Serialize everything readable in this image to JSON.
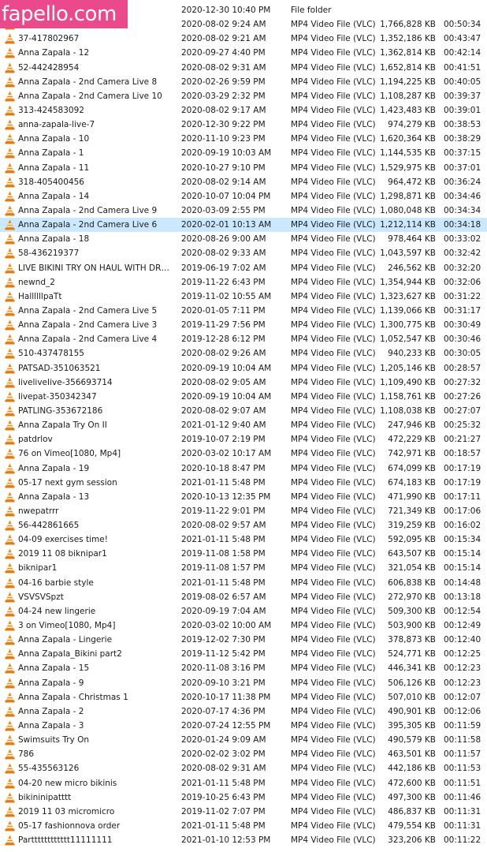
{
  "watermark": "fapello.com",
  "icon": "vlc-cone-icon",
  "colors": {
    "cone_orange": "#f08a16",
    "cone_stripe": "#ffffff",
    "selected_row": "#cce8ff",
    "watermark_bg": "#ea4a8c"
  },
  "rows": [
    {
      "name": "",
      "date": "2020-12-30 10:40 PM",
      "type": "File folder",
      "size": "",
      "duration": ""
    },
    {
      "name": "",
      "date": "2020-08-02 9:24 AM",
      "type": "MP4 Video File (VLC)",
      "size": "1,766,828 KB",
      "duration": "00:50:34"
    },
    {
      "name": "37-417802967",
      "date": "2020-08-02 9:21 AM",
      "type": "MP4 Video File (VLC)",
      "size": "1,352,186 KB",
      "duration": "00:43:47"
    },
    {
      "name": "Anna Zapala - 12",
      "date": "2020-09-27 4:40 PM",
      "type": "MP4 Video File (VLC)",
      "size": "1,362,814 KB",
      "duration": "00:42:14"
    },
    {
      "name": "52-442428954",
      "date": "2020-08-02 9:31 AM",
      "type": "MP4 Video File (VLC)",
      "size": "1,652,814 KB",
      "duration": "00:41:51"
    },
    {
      "name": "Anna Zapala - 2nd Camera Live 8",
      "date": "2020-02-26 9:59 PM",
      "type": "MP4 Video File (VLC)",
      "size": "1,194,225 KB",
      "duration": "00:40:05"
    },
    {
      "name": "Anna Zapala - 2nd Camera Live 10",
      "date": "2020-03-29 2:32 PM",
      "type": "MP4 Video File (VLC)",
      "size": "1,108,287 KB",
      "duration": "00:39:37"
    },
    {
      "name": "313-424583092",
      "date": "2020-08-02 9:17 AM",
      "type": "MP4 Video File (VLC)",
      "size": "1,423,483 KB",
      "duration": "00:39:01"
    },
    {
      "name": "anna-zapala-live-7",
      "date": "2020-12-30 9:22 PM",
      "type": "MP4 Video File (VLC)",
      "size": "974,279 KB",
      "duration": "00:38:53"
    },
    {
      "name": "Anna Zapala - 10",
      "date": "2020-11-10 9:23 PM",
      "type": "MP4 Video File (VLC)",
      "size": "1,620,364 KB",
      "duration": "00:38:29"
    },
    {
      "name": "Anna Zapala - 1",
      "date": "2020-09-19 10:03 AM",
      "type": "MP4 Video File (VLC)",
      "size": "1,144,535 KB",
      "duration": "00:37:15"
    },
    {
      "name": "Anna Zapala - 11",
      "date": "2020-10-27 9:10 PM",
      "type": "MP4 Video File (VLC)",
      "size": "1,529,975 KB",
      "duration": "00:37:01"
    },
    {
      "name": "318-405400456",
      "date": "2020-08-02 9:14 AM",
      "type": "MP4 Video File (VLC)",
      "size": "964,472 KB",
      "duration": "00:36:24"
    },
    {
      "name": "Anna Zapala - 14",
      "date": "2020-10-07 10:04 PM",
      "type": "MP4 Video File (VLC)",
      "size": "1,298,871 KB",
      "duration": "00:34:46"
    },
    {
      "name": "Anna Zapala - 2nd Camera Live 9",
      "date": "2020-03-09 2:55 PM",
      "type": "MP4 Video File (VLC)",
      "size": "1,080,048 KB",
      "duration": "00:34:34"
    },
    {
      "name": "Anna Zapala - 2nd Camera Live 6",
      "date": "2020-02-01 10:13 AM",
      "type": "MP4 Video File (VLC)",
      "size": "1,212,114 KB",
      "duration": "00:34:18",
      "selected": true
    },
    {
      "name": "Anna Zapala - 18",
      "date": "2020-08-26 9:00 AM",
      "type": "MP4 Video File (VLC)",
      "size": "978,464 KB",
      "duration": "00:33:02"
    },
    {
      "name": "58-436219377",
      "date": "2020-08-02 9:33 AM",
      "type": "MP4 Video File (VLC)",
      "size": "1,043,597 KB",
      "duration": "00:32:42"
    },
    {
      "name": "LIVE  BIKINI TRY ON HAUL WITH DRESSLI...",
      "date": "2019-06-19 7:02 AM",
      "type": "MP4 Video File (VLC)",
      "size": "246,562 KB",
      "duration": "00:32:20"
    },
    {
      "name": "newnd_2",
      "date": "2019-11-22 6:43 PM",
      "type": "MP4 Video File (VLC)",
      "size": "1,354,944 KB",
      "duration": "00:32:06"
    },
    {
      "name": "HallllllpaTt",
      "date": "2019-11-02 10:55 AM",
      "type": "MP4 Video File (VLC)",
      "size": "1,323,627 KB",
      "duration": "00:31:22"
    },
    {
      "name": "Anna Zapala - 2nd Camera Live 5",
      "date": "2020-01-05 7:11 PM",
      "type": "MP4 Video File (VLC)",
      "size": "1,139,066 KB",
      "duration": "00:31:17"
    },
    {
      "name": "Anna Zapala - 2nd Camera Live 3",
      "date": "2019-11-29 7:56 PM",
      "type": "MP4 Video File (VLC)",
      "size": "1,300,775 KB",
      "duration": "00:30:49"
    },
    {
      "name": "Anna Zapala - 2nd Camera Live 4",
      "date": "2019-12-28 6:12 PM",
      "type": "MP4 Video File (VLC)",
      "size": "1,052,547 KB",
      "duration": "00:30:46"
    },
    {
      "name": "510-437478155",
      "date": "2020-08-02 9:26 AM",
      "type": "MP4 Video File (VLC)",
      "size": "940,233 KB",
      "duration": "00:30:05"
    },
    {
      "name": "PATSAD-351063521",
      "date": "2020-09-19 10:04 AM",
      "type": "MP4 Video File (VLC)",
      "size": "1,205,146 KB",
      "duration": "00:28:57"
    },
    {
      "name": "liveliveIive-356693714",
      "date": "2020-08-02 9:05 AM",
      "type": "MP4 Video File (VLC)",
      "size": "1,109,490 KB",
      "duration": "00:27:32"
    },
    {
      "name": "livepat-350342347",
      "date": "2020-09-19 10:04 AM",
      "type": "MP4 Video File (VLC)",
      "size": "1,158,761 KB",
      "duration": "00:27:26"
    },
    {
      "name": "PATLING-353672186",
      "date": "2020-08-02 9:07 AM",
      "type": "MP4 Video File (VLC)",
      "size": "1,108,038 KB",
      "duration": "00:27:07"
    },
    {
      "name": "Anna Zapala Try On II",
      "date": "2021-01-12 9:40 AM",
      "type": "MP4 Video File (VLC)",
      "size": "247,946 KB",
      "duration": "00:25:32"
    },
    {
      "name": "patdrlov",
      "date": "2019-10-07 2:19 PM",
      "type": "MP4 Video File (VLC)",
      "size": "472,229 KB",
      "duration": "00:21:27"
    },
    {
      "name": "76 on Vimeo[1080, Mp4]",
      "date": "2020-03-02 10:17 AM",
      "type": "MP4 Video File (VLC)",
      "size": "742,971 KB",
      "duration": "00:18:57"
    },
    {
      "name": "Anna Zapala - 19",
      "date": "2020-10-18 8:47 PM",
      "type": "MP4 Video File (VLC)",
      "size": "674,099 KB",
      "duration": "00:17:19"
    },
    {
      "name": "05-17 next gym session",
      "date": "2021-01-11 5:48 PM",
      "type": "MP4 Video File (VLC)",
      "size": "674,183 KB",
      "duration": "00:17:19"
    },
    {
      "name": "Anna Zapala - 13",
      "date": "2020-10-13 12:35 PM",
      "type": "MP4 Video File (VLC)",
      "size": "471,990 KB",
      "duration": "00:17:11"
    },
    {
      "name": "nwepatrrr",
      "date": "2019-11-22 9:01 PM",
      "type": "MP4 Video File (VLC)",
      "size": "721,349 KB",
      "duration": "00:17:06"
    },
    {
      "name": "56-442861665",
      "date": "2020-08-02 9:57 AM",
      "type": "MP4 Video File (VLC)",
      "size": "319,259 KB",
      "duration": "00:16:02"
    },
    {
      "name": "04-09 exercises time!",
      "date": "2021-01-11 5:48 PM",
      "type": "MP4 Video File (VLC)",
      "size": "592,095 KB",
      "duration": "00:15:34"
    },
    {
      "name": "2019 11 08 biknipar1",
      "date": "2019-11-08 1:58 PM",
      "type": "MP4 Video File (VLC)",
      "size": "643,507 KB",
      "duration": "00:15:14"
    },
    {
      "name": "biknipar1",
      "date": "2019-11-08 1:57 PM",
      "type": "MP4 Video File (VLC)",
      "size": "321,054 KB",
      "duration": "00:15:14"
    },
    {
      "name": "04-16 barbie style",
      "date": "2021-01-11 5:48 PM",
      "type": "MP4 Video File (VLC)",
      "size": "606,838 KB",
      "duration": "00:14:48"
    },
    {
      "name": "VSVSVSpzt",
      "date": "2019-08-02 6:57 AM",
      "type": "MP4 Video File (VLC)",
      "size": "272,970 KB",
      "duration": "00:13:18"
    },
    {
      "name": "04-24 new lingerie",
      "date": "2020-09-19 7:04 AM",
      "type": "MP4 Video File (VLC)",
      "size": "509,300 KB",
      "duration": "00:12:54"
    },
    {
      "name": "3 on Vimeo[1080, Mp4]",
      "date": "2020-03-02 10:00 AM",
      "type": "MP4 Video File (VLC)",
      "size": "503,900 KB",
      "duration": "00:12:49"
    },
    {
      "name": "Anna Zapala - Lingerie",
      "date": "2019-12-02 7:30 PM",
      "type": "MP4 Video File (VLC)",
      "size": "378,873 KB",
      "duration": "00:12:40"
    },
    {
      "name": "Anna Zapala_Bikini part2",
      "date": "2019-11-12 5:42 PM",
      "type": "MP4 Video File (VLC)",
      "size": "524,771 KB",
      "duration": "00:12:25"
    },
    {
      "name": "Anna Zapala - 15",
      "date": "2020-11-08 3:16 PM",
      "type": "MP4 Video File (VLC)",
      "size": "446,341 KB",
      "duration": "00:12:23"
    },
    {
      "name": "Anna Zapala - 9",
      "date": "2020-09-10 3:21 PM",
      "type": "MP4 Video File (VLC)",
      "size": "506,126 KB",
      "duration": "00:12:23"
    },
    {
      "name": "Anna Zapala - Christmas 1",
      "date": "2020-10-17 11:38 PM",
      "type": "MP4 Video File (VLC)",
      "size": "507,010 KB",
      "duration": "00:12:07"
    },
    {
      "name": "Anna Zapala - 2",
      "date": "2020-07-17 4:36 PM",
      "type": "MP4 Video File (VLC)",
      "size": "490,901 KB",
      "duration": "00:12:06"
    },
    {
      "name": "Anna Zapala - 3",
      "date": "2020-07-24 12:55 PM",
      "type": "MP4 Video File (VLC)",
      "size": "395,305 KB",
      "duration": "00:11:59"
    },
    {
      "name": "Swimsuits Try On",
      "date": "2020-01-24 9:09 AM",
      "type": "MP4 Video File (VLC)",
      "size": "490,579 KB",
      "duration": "00:11:58"
    },
    {
      "name": "786",
      "date": "2020-02-02 3:02 PM",
      "type": "MP4 Video File (VLC)",
      "size": "463,501 KB",
      "duration": "00:11:57"
    },
    {
      "name": "55-435563126",
      "date": "2020-08-02 9:31 AM",
      "type": "MP4 Video File (VLC)",
      "size": "442,186 KB",
      "duration": "00:11:53"
    },
    {
      "name": "04-20 new micro bikinis",
      "date": "2021-01-11 5:48 PM",
      "type": "MP4 Video File (VLC)",
      "size": "472,600 KB",
      "duration": "00:11:51"
    },
    {
      "name": "bikininipatttt",
      "date": "2019-10-25 6:43 PM",
      "type": "MP4 Video File (VLC)",
      "size": "497,300 KB",
      "duration": "00:11:46"
    },
    {
      "name": "2019 11 03 micromicro",
      "date": "2019-11-02 7:07 PM",
      "type": "MP4 Video File (VLC)",
      "size": "486,837 KB",
      "duration": "00:11:31"
    },
    {
      "name": "05-17 fashionnova order",
      "date": "2021-01-11 5:48 PM",
      "type": "MP4 Video File (VLC)",
      "size": "479,554 KB",
      "duration": "00:11:31"
    },
    {
      "name": "Partttttttttttt11111111",
      "date": "2021-01-10 12:53 PM",
      "type": "MP4 Video File (VLC)",
      "size": "323,206 KB",
      "duration": "00:11:22"
    }
  ]
}
